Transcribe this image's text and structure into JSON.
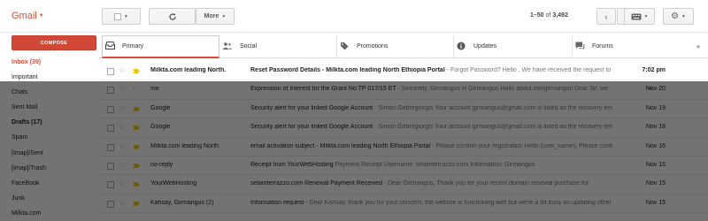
{
  "app": {
    "logo": "Gmail",
    "compose_label": "COMPOSE",
    "more_label": "More"
  },
  "pager": {
    "range": "1–50",
    "of": "of",
    "total": "3,492"
  },
  "icons": {
    "refresh": "refresh-icon",
    "keyboard": "keyboard-icon",
    "settings": "gear-icon",
    "prev": "chevron-left-icon",
    "next": "chevron-right-icon"
  },
  "sidebar": {
    "items": [
      {
        "label": "Inbox (39)"
      },
      {
        "label": "Important"
      },
      {
        "label": "Chats"
      },
      {
        "label": "Sent Mail"
      },
      {
        "label": "Drafts (17)"
      },
      {
        "label": "Spam"
      },
      {
        "label": "[Imap]/Sent"
      },
      {
        "label": "[Imap]/Trash"
      },
      {
        "label": "FaceBook"
      },
      {
        "label": "Junk"
      },
      {
        "label": "Milkta.com"
      }
    ]
  },
  "tabs": [
    {
      "label": "Primary",
      "icon": "inbox-icon"
    },
    {
      "label": "Social",
      "icon": "people-icon"
    },
    {
      "label": "Promotions",
      "icon": "tag-icon"
    },
    {
      "label": "Updates",
      "icon": "info-icon"
    },
    {
      "label": "Forums",
      "icon": "chat-icon"
    }
  ],
  "add_tab": "+",
  "messages": [
    {
      "sender": "Milkta.com leading North.",
      "subject": "Reset Password Details - Milkta.com leading North Ethiopia Portal",
      "snippet": " - Forgot Password? Hello , We have received the request to",
      "date": "7:02 pm",
      "important": true
    },
    {
      "sender": "me",
      "subject": "Expression of Interest for the Grant No TP 017/15 ET",
      "snippet": " - Sincerely, Girmangus H Girmangus Hallo about.me/girmangus Dear Sir, we",
      "date": "Nov 20",
      "important": false
    },
    {
      "sender": "Google",
      "subject": "Security alert for your linked Google Account",
      "snippet": " - Simon Gebregiorgis Your account girmangus@gmail.com is listed as the recovery em",
      "date": "Nov 19",
      "important": true
    },
    {
      "sender": "Google",
      "subject": "Security alert for your linked Google Account",
      "snippet": " - Simon Gebregiorgis Your account girmangus@gmail.com is listed as the recovery em",
      "date": "Nov 18",
      "important": true
    },
    {
      "sender": "Milkta.com leading North.",
      "subject": "email activation subject - Milkta.com leading North Ethiopia Portal",
      "snippet": " - Please confirm your registration Hello {user_name}, Please confi",
      "date": "Nov 16",
      "important": true
    },
    {
      "sender": "no-reply",
      "subject": "Receipt from YourWebHosting",
      "snippet": " Payment Receipt Username: selamterrazzo.com Information: Girmangus",
      "date": "Nov 15",
      "important": true
    },
    {
      "sender": "YourWebHosting",
      "subject": "selamterrazzo.com Renewal Payment Received",
      "snippet": " - Dear Girmangus, Thank you for your recent domain renewal purchase for",
      "date": "Nov 15",
      "important": true
    },
    {
      "sender": "Kahsay, Girmangus (2)",
      "subject": "Information request",
      "snippet": " - Dear Kahsay, thank you for your concern, the website is functioning well but we're a bit busy on updating other",
      "date": "Nov 15",
      "important": true
    }
  ]
}
